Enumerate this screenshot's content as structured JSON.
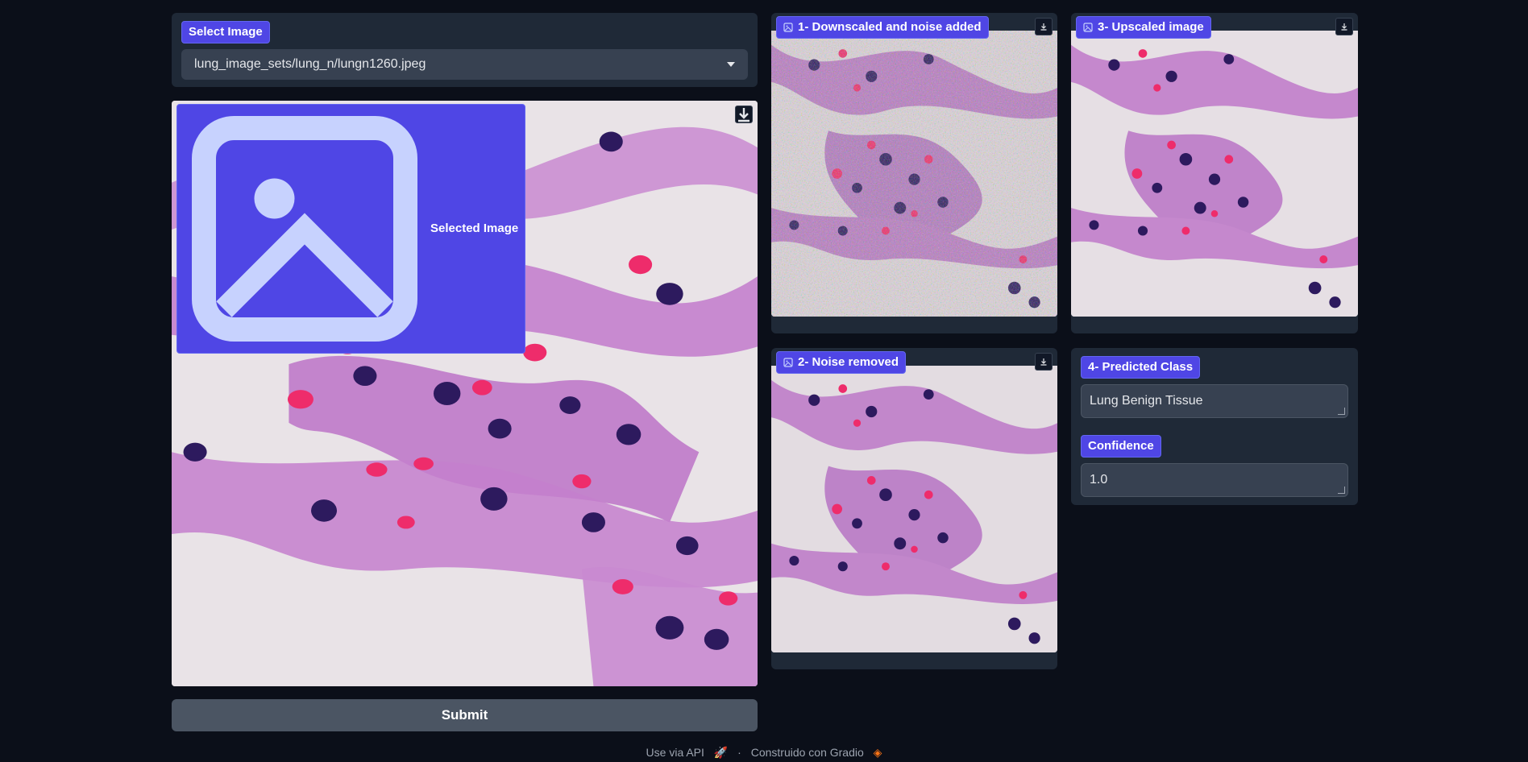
{
  "select_panel": {
    "label": "Select Image",
    "selected_value": "lung_image_sets/lung_n/lungn1260.jpeg"
  },
  "selected_image": {
    "label": "Selected Image"
  },
  "outputs": {
    "downscaled": {
      "label": "1- Downscaled and noise added"
    },
    "noise_removed": {
      "label": "2- Noise removed"
    },
    "upscaled": {
      "label": "3- Upscaled image"
    },
    "predicted_class": {
      "label": "4- Predicted Class",
      "value": "Lung Benign Tissue"
    },
    "confidence": {
      "label": "Confidence",
      "value": "1.0"
    }
  },
  "submit_label": "Submit",
  "footer": {
    "api_link": "Use via API",
    "separator": "·",
    "built_with": "Construido con Gradio"
  },
  "icons": {
    "image": "image-icon",
    "download": "download-icon",
    "dropdown": "chevron-down-icon",
    "rocket": "rocket-icon",
    "gradio_logo": "gradio-logo-icon"
  },
  "colors": {
    "background": "#0b0f19",
    "panel": "#1f2937",
    "accent": "#4f46e5",
    "input": "#374151",
    "button": "#4b5563"
  }
}
